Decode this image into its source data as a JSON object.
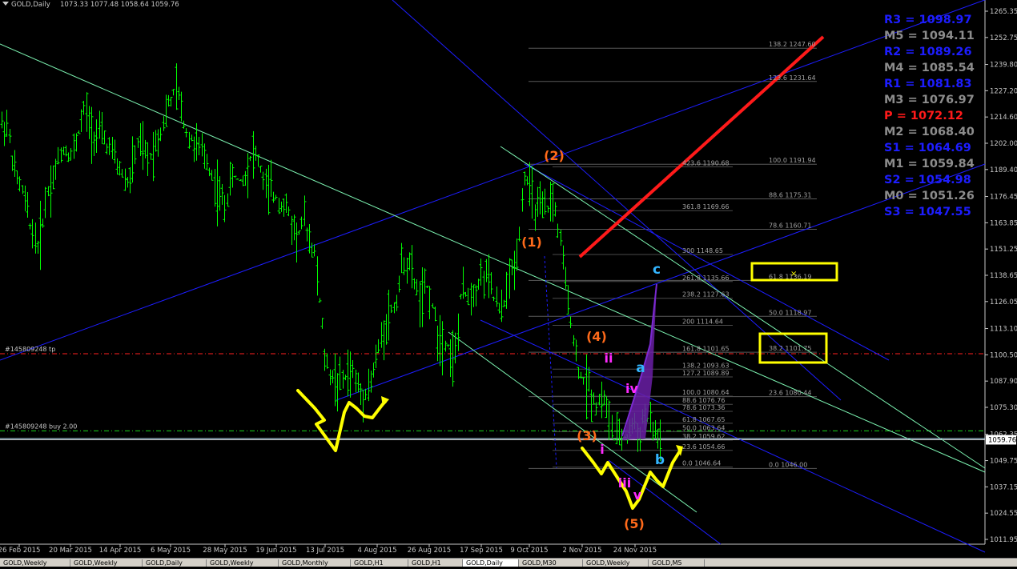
{
  "header": {
    "title": "GOLD,Daily",
    "ohlc": "1073.33 1077.48 1058.64 1059.76"
  },
  "colors": {
    "background": "#000000",
    "candle": "#00ff00",
    "channel_blue": "#1d1dff",
    "channel_green": "#7cf3b1",
    "red_trend": "#ff1a1a",
    "yellow": "#ffff00",
    "wave_orange": "#ff6a1a",
    "wave_magenta": "#ff2aff",
    "wave_cyan": "#33b5ff",
    "purple": "#6a1fa6"
  },
  "chart_data": {
    "type": "candlestick",
    "symbol": "GOLD",
    "timeframe": "Daily",
    "ohlc_last": {
      "open": 1073.33,
      "high": 1077.48,
      "low": 1058.64,
      "close": 1059.76
    },
    "ylim": [
      1011.95,
      1265.35
    ],
    "y_ticks": [
      1265.35,
      1252.75,
      1239.8,
      1227.2,
      1214.6,
      1202.0,
      1189.4,
      1176.45,
      1163.85,
      1151.25,
      1138.65,
      1126.05,
      1113.1,
      1100.5,
      1087.9,
      1075.3,
      1062.35,
      1049.75,
      1037.15,
      1024.55,
      1011.95
    ],
    "x_ticks": [
      "26 Feb 2015",
      "20 Mar 2015",
      "14 Apr 2015",
      "6 May 2015",
      "28 May 2015",
      "19 Jun 2015",
      "13 Jul 2015",
      "4 Aug 2015",
      "26 Aug 2015",
      "17 Sep 2015",
      "9 Oct 2015",
      "2 Nov 2015",
      "24 Nov 2015"
    ],
    "current_price": "1059.76",
    "pivots": [
      {
        "label": "R3",
        "value": "1098.97",
        "color": "#1d1dff"
      },
      {
        "label": "M5",
        "value": "1094.11",
        "color": "#8c8c8c"
      },
      {
        "label": "R2",
        "value": "1089.26",
        "color": "#1d1dff"
      },
      {
        "label": "M4",
        "value": "1085.54",
        "color": "#8c8c8c"
      },
      {
        "label": "R1",
        "value": "1081.83",
        "color": "#1d1dff"
      },
      {
        "label": "M3",
        "value": "1076.97",
        "color": "#8c8c8c"
      },
      {
        "label": "P ",
        "value": "1072.12",
        "color": "#ff1a1a"
      },
      {
        "label": "M2",
        "value": "1068.40",
        "color": "#8c8c8c"
      },
      {
        "label": "S1",
        "value": "1064.69",
        "color": "#1d1dff"
      },
      {
        "label": "M1",
        "value": "1059.84",
        "color": "#8c8c8c"
      },
      {
        "label": "S2",
        "value": "1054.98",
        "color": "#1d1dff"
      },
      {
        "label": "M0",
        "value": "1051.26",
        "color": "#8c8c8c"
      },
      {
        "label": "S3",
        "value": "1047.55",
        "color": "#1d1dff"
      }
    ],
    "fib_upper": [
      {
        "level": "138.2",
        "price": "1247.60",
        "y": 1247.6
      },
      {
        "level": "123.6",
        "price": "1231.64",
        "y": 1231.64
      },
      {
        "level": "100.0",
        "price": "1191.94",
        "y": 1191.94
      },
      {
        "level": "88.6",
        "price": "1175.31",
        "y": 1175.31
      },
      {
        "level": "78.6",
        "price": "1160.71",
        "y": 1160.71
      },
      {
        "level": "61.8",
        "price": "1136.19",
        "y": 1136.19
      },
      {
        "level": "50.0",
        "price": "1118.97",
        "y": 1118.97
      },
      {
        "level": "38.2",
        "price": "1101.75",
        "y": 1101.75
      },
      {
        "level": "23.6",
        "price": "1080.44",
        "y": 1080.44
      },
      {
        "level": "0.0",
        "price": "1046.00",
        "y": 1046.0
      }
    ],
    "fib_ext": [
      {
        "level": "423.6",
        "price": "1190.68",
        "y": 1190.68
      },
      {
        "level": "361.8",
        "price": "1169.66",
        "y": 1169.66
      },
      {
        "level": "300",
        "price": "1148.65",
        "y": 1148.65
      },
      {
        "level": "261.8",
        "price": "1135.66",
        "y": 1135.66
      },
      {
        "level": "238.2",
        "price": "1127.63",
        "y": 1127.63
      },
      {
        "level": "200",
        "price": "1114.64",
        "y": 1114.64
      },
      {
        "level": "161.8",
        "price": "1101.65",
        "y": 1101.65
      },
      {
        "level": "138.2",
        "price": "1093.63",
        "y": 1093.63
      },
      {
        "level": "127.2",
        "price": "1089.89",
        "y": 1089.89
      },
      {
        "level": "100.0",
        "price": "1080.64",
        "y": 1080.64
      },
      {
        "level": "88.6",
        "price": "1076.76",
        "y": 1076.76
      },
      {
        "level": "78.6",
        "price": "1073.36",
        "y": 1073.36
      },
      {
        "level": "61.8",
        "price": "1067.65",
        "y": 1067.65
      },
      {
        "level": "50.0",
        "price": "1063.64",
        "y": 1063.64
      },
      {
        "level": "38.2",
        "price": "1059.62",
        "y": 1059.62
      },
      {
        "level": "23.6",
        "price": "1054.66",
        "y": 1054.66
      },
      {
        "level": "0.0",
        "price": "1046.64",
        "y": 1046.64
      }
    ],
    "horizontal_lines": [
      {
        "text": "#145809248 tp",
        "y": 1101.0,
        "style": "red-dash"
      },
      {
        "text": "#145809248 buy 2.00",
        "y": 1064.0,
        "style": "green-dashdot"
      }
    ],
    "wave_labels": [
      "(1)",
      "(2)",
      "(3)",
      "(4)",
      "(5)",
      "i",
      "ii",
      "iii",
      "iv",
      "v",
      "a",
      "b",
      "c"
    ]
  },
  "tabs": [
    "GOLD,Weekly",
    "GOLD,Weekly",
    "GOLD,Daily",
    "GOLD,Weekly",
    "GOLD,Monthly",
    "GOLD,H1",
    "GOLD,H1",
    "GOLD,Daily",
    "GOLD,M30",
    "GOLD,Weekly",
    "GOLD,M5"
  ]
}
